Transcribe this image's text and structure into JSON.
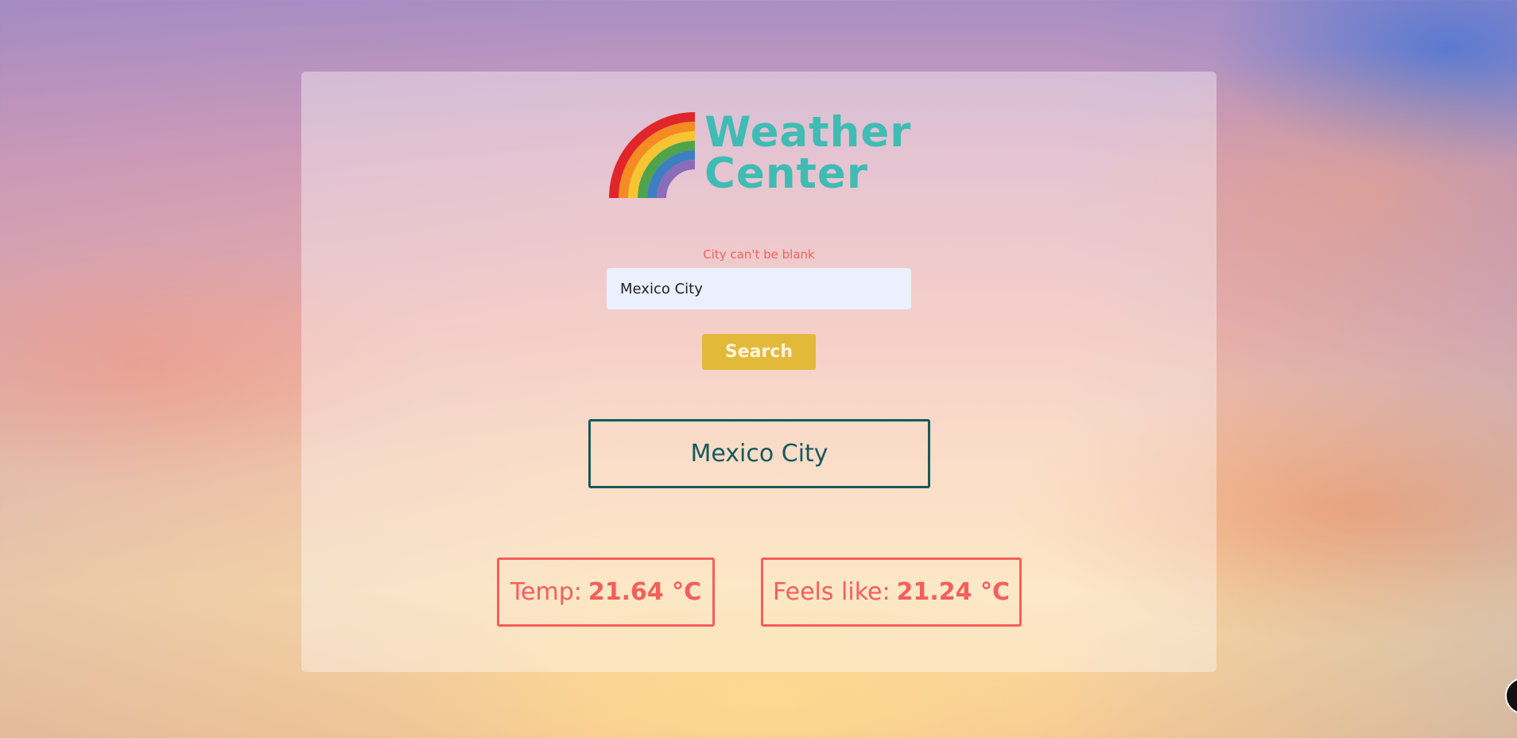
{
  "app": {
    "logo_line1": "Weather",
    "logo_line2": "Center"
  },
  "search": {
    "error_message": "City can't be blank",
    "input_value": "Mexico City",
    "button_label": "Search"
  },
  "result": {
    "city": "Mexico City",
    "temp_label": "Temp:",
    "temp_value": "21.64 °C",
    "feels_label": "Feels like:",
    "feels_value": "21.24 °C"
  },
  "colors": {
    "accent_teal": "#3fbcb3",
    "city_border": "#17595c",
    "stat_red": "#f55e5a",
    "button_gold": "#e3b93a",
    "input_bg": "#eaf0fd"
  },
  "icons": {
    "logo": "rainbow-icon"
  }
}
